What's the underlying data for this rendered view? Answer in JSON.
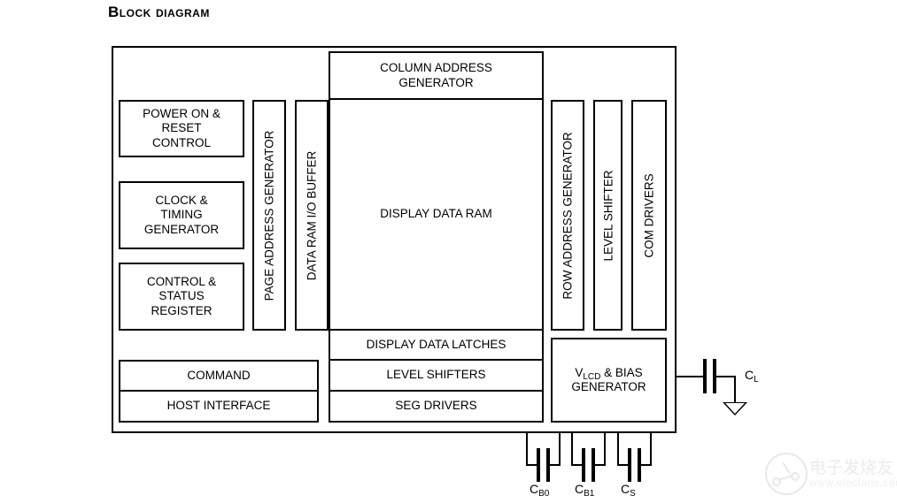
{
  "page": {
    "title": "Block Diagram"
  },
  "diagram": {
    "left_blocks": [
      {
        "label": "POWER ON &\nRESET\nCONTROL",
        "name": "power-on-reset-control-block"
      },
      {
        "label": "CLOCK &\nTIMING\nGENERATOR",
        "name": "clock-timing-generator-block"
      },
      {
        "label": "CONTROL &\nSTATUS\nREGISTER",
        "name": "control-status-register-block"
      }
    ],
    "vertical_left": [
      {
        "label": "PAGE ADDRESS GENERATOR",
        "name": "page-address-generator-block"
      },
      {
        "label": "DATA RAM I/O BUFFER",
        "name": "data-ram-io-buffer-block"
      }
    ],
    "center": {
      "column_address_generator": "COLUMN ADDRESS\nGENERATOR",
      "display_data_ram": "DISPLAY DATA RAM",
      "display_data_latches": "DISPLAY DATA LATCHES",
      "level_shifters": "LEVEL SHIFTERS",
      "seg_drivers": "SEG DRIVERS"
    },
    "vertical_right": [
      {
        "label": "ROW ADDRESS GENERATOR",
        "name": "row-address-generator-block"
      },
      {
        "label": "LEVEL SHIFTER",
        "name": "level-shifter-block"
      },
      {
        "label": "COM DRIVERS",
        "name": "com-drivers-block"
      }
    ],
    "bottom_left": {
      "command": "COMMAND",
      "host_interface": "HOST INTERFACE"
    },
    "vlcd_block": {
      "line1_prefix": "V",
      "line1_sub": "LCD",
      "line1_suffix": " & BIAS",
      "line2": "GENERATOR"
    },
    "capacitors": [
      {
        "name": "capacitor-cl",
        "base": "C",
        "sub": "L"
      },
      {
        "name": "capacitor-cb0",
        "base": "C",
        "sub": "B0"
      },
      {
        "name": "capacitor-cb1",
        "base": "C",
        "sub": "B1"
      },
      {
        "name": "capacitor-cs",
        "base": "C",
        "sub": "S"
      }
    ]
  },
  "watermark": {
    "chinese": "电子发烧友",
    "url": "www.elecfans.com"
  },
  "colors": {
    "line": "#000000",
    "background": "#ffffff",
    "watermark": "#888888"
  }
}
